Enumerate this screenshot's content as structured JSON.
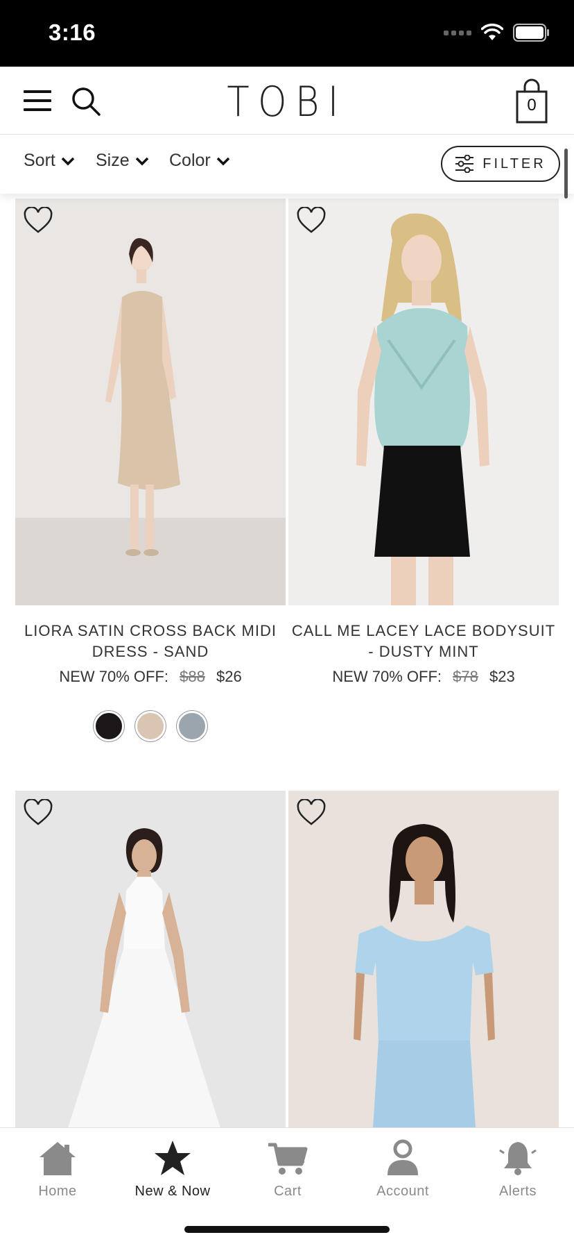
{
  "status_bar": {
    "time": "3:16"
  },
  "header": {
    "logo": "TOBI",
    "cart_count": "0"
  },
  "filters": {
    "sort_label": "Sort",
    "size_label": "Size",
    "color_label": "Color",
    "filter_button_label": "FILTER"
  },
  "products": [
    {
      "name": "LIORA SATIN CROSS BACK MIDI DRESS - SAND",
      "price_prefix": "NEW 70% OFF:",
      "original_price": "$88",
      "sale_price": "$26",
      "swatch_colors": [
        "#1b1617",
        "#d9c5b2",
        "#9ba5ae"
      ]
    },
    {
      "name": "CALL ME LACEY LACE BODYSUIT - DUSTY MINT",
      "price_prefix": "NEW 70% OFF:",
      "original_price": "$78",
      "sale_price": "$23"
    }
  ],
  "tabs": [
    {
      "label": "Home",
      "icon": "home-icon"
    },
    {
      "label": "New & Now",
      "icon": "star-icon",
      "active": true
    },
    {
      "label": "Cart",
      "icon": "cart-icon"
    },
    {
      "label": "Account",
      "icon": "account-icon"
    },
    {
      "label": "Alerts",
      "icon": "bell-icon"
    }
  ],
  "colors": {
    "accent": "#222222",
    "inactive_tab": "#8a8a8a",
    "status_bar_bg": "#000000"
  }
}
